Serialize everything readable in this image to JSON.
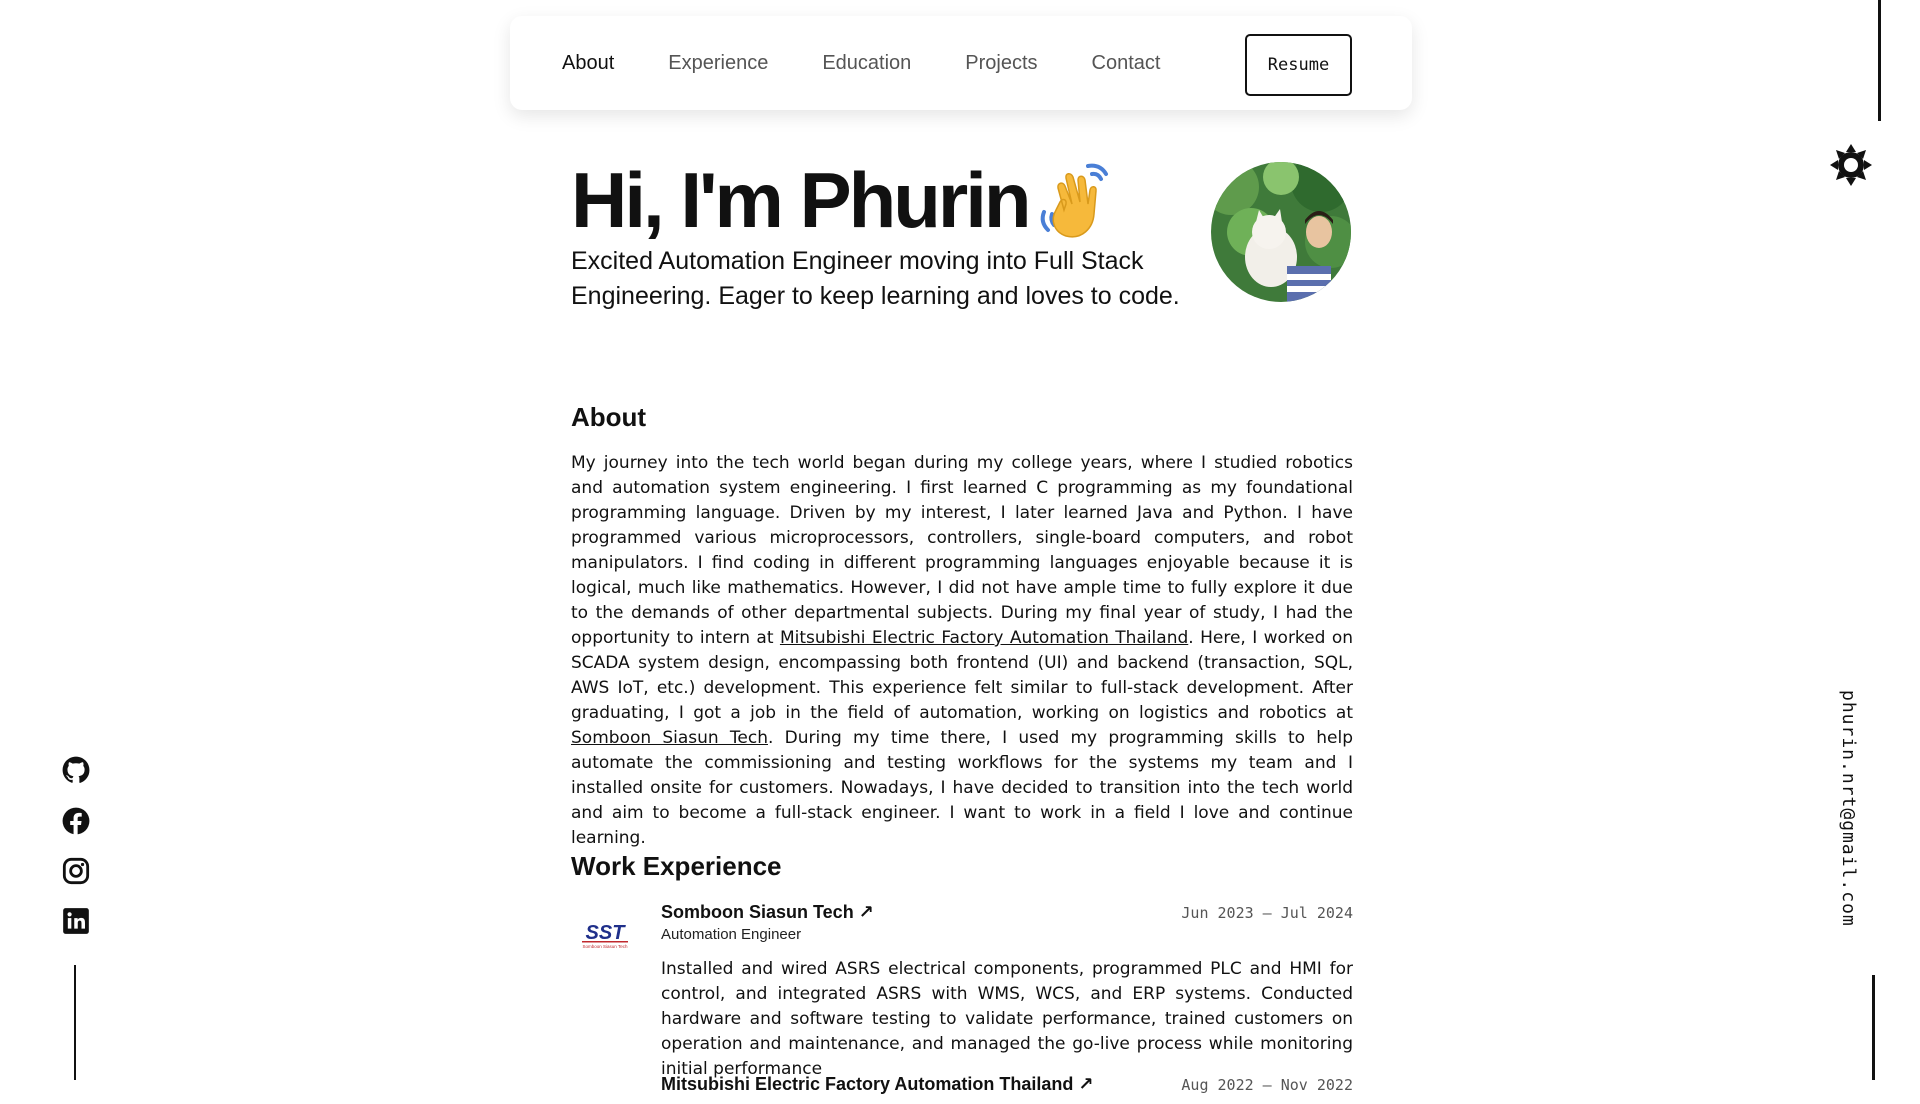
{
  "nav": {
    "links": [
      {
        "label": "About",
        "active": true
      },
      {
        "label": "Experience",
        "active": false
      },
      {
        "label": "Education",
        "active": false
      },
      {
        "label": "Projects",
        "active": false
      },
      {
        "label": "Contact",
        "active": false
      }
    ],
    "resume_label": "Resume"
  },
  "hero": {
    "greeting": "Hi, I'm Phurin",
    "wave_icon": "waving-hand-icon",
    "subtitle": "Excited Automation Engineer moving into Full Stack Engineering. Eager to keep learning and loves to code."
  },
  "about": {
    "title": "About",
    "text_1": "My journey into the tech world began during my college years, where I studied robotics and automation system engineering. I first learned C programming as my foundational programming language. Driven by my interest, I later learned Java and Python. I have programmed various microprocessors, controllers, single-board computers, and robot manipulators. I find coding in different programming languages enjoyable because it is logical, much like mathematics. However, I did not have ample time to fully explore it due to the demands of other departmental subjects. During my final year of study, I had the opportunity to intern at ",
    "link_1": "Mitsubishi Electric Factory Automation Thailand",
    "text_2": ". Here, I worked on SCADA system design, encompassing both frontend (UI) and backend (transaction, SQL, AWS IoT, etc.) development. This experience felt similar to full-stack development. After graduating, I got a job in the field of automation, working on logistics and robotics at ",
    "link_2": "Somboon Siasun Tech",
    "text_3": ". During my time there, I used my programming skills to help automate the commissioning and testing workflows for the systems my team and I installed onsite for customers. Nowadays, I have decided to transition into the tech world and aim to become a full-stack engineer. I want to work in a field I love and continue learning."
  },
  "experience": {
    "title": "Work Experience",
    "items": [
      {
        "company": "Somboon Siasun Tech ↗",
        "role": "Automation Engineer",
        "dates": "Jun 2023 — Jul 2024",
        "logo_text": "SST",
        "logo_subtext": "Somboon Siasun Tech",
        "description": "Installed and wired ASRS electrical components, programmed PLC and HMI for control, and integrated ASRS with WMS, WCS, and ERP systems. Conducted hardware and software testing to validate performance, trained customers on operation and maintenance, and managed the go-live process while monitoring initial performance"
      },
      {
        "company": "Mitsubishi Electric Factory Automation Thailand ↗",
        "dates": "Aug 2022 — Nov 2022"
      }
    ]
  },
  "contact": {
    "email": "phurin.nrt@gmail.com"
  },
  "socials": [
    "github-icon",
    "facebook-icon",
    "instagram-icon",
    "linkedin-icon"
  ],
  "theme_icon": "sun-icon"
}
